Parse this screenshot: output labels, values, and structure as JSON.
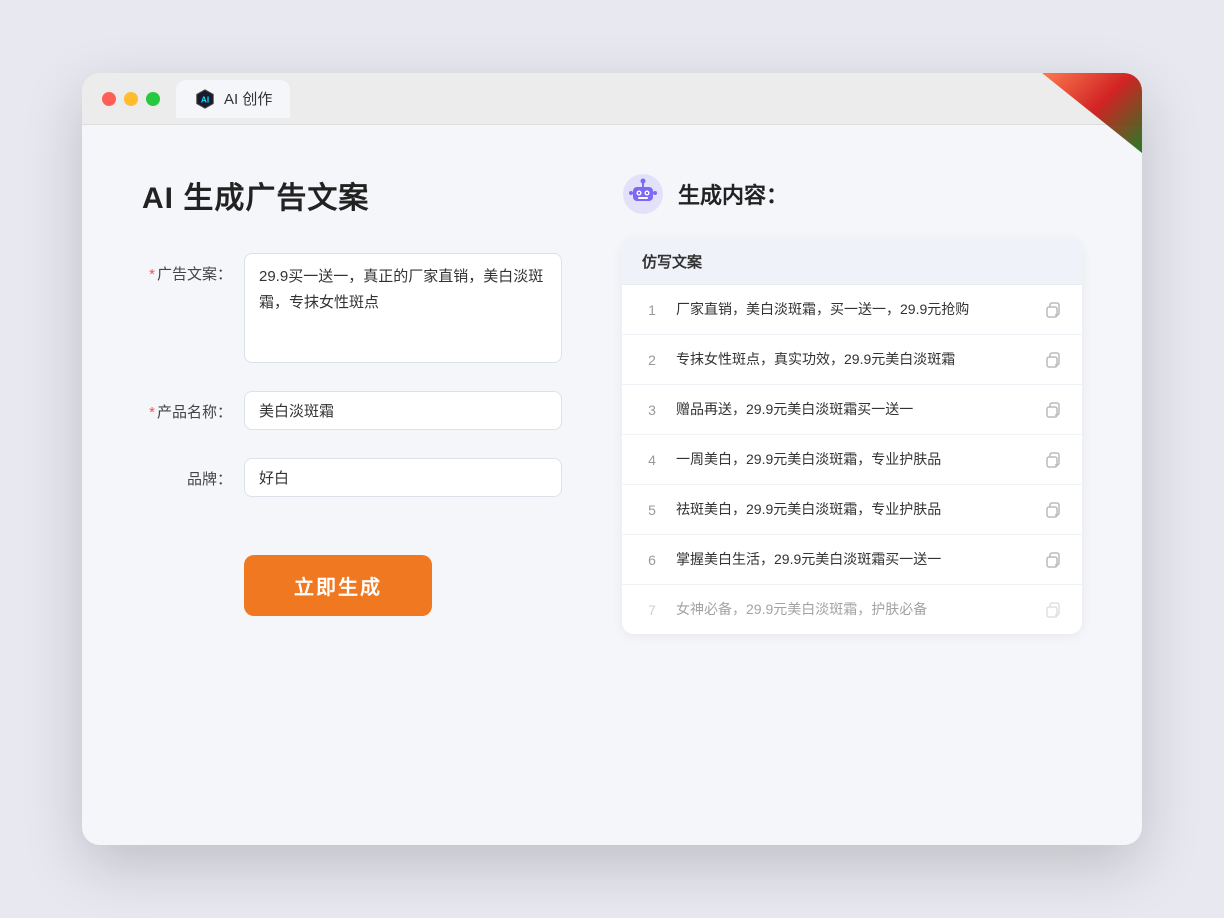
{
  "browser": {
    "tab_label": "AI 创作",
    "traffic_lights": [
      "red",
      "yellow",
      "green"
    ]
  },
  "left": {
    "page_title": "AI 生成广告文案",
    "fields": [
      {
        "id": "ad_copy",
        "label": "广告文案：",
        "required": true,
        "type": "textarea",
        "value": "29.9买一送一，真正的厂家直销，美白淡斑霜，专抹女性斑点"
      },
      {
        "id": "product_name",
        "label": "产品名称：",
        "required": true,
        "type": "input",
        "value": "美白淡斑霜"
      },
      {
        "id": "brand",
        "label": "品牌：",
        "required": false,
        "type": "input",
        "value": "好白"
      }
    ],
    "generate_btn": "立即生成"
  },
  "right": {
    "header_title": "生成内容：",
    "table_header": "仿写文案",
    "results": [
      {
        "num": "1",
        "text": "厂家直销，美白淡斑霜，买一送一，29.9元抢购",
        "faded": false
      },
      {
        "num": "2",
        "text": "专抹女性斑点，真实功效，29.9元美白淡斑霜",
        "faded": false
      },
      {
        "num": "3",
        "text": "赠品再送，29.9元美白淡斑霜买一送一",
        "faded": false
      },
      {
        "num": "4",
        "text": "一周美白，29.9元美白淡斑霜，专业护肤品",
        "faded": false
      },
      {
        "num": "5",
        "text": "祛斑美白，29.9元美白淡斑霜，专业护肤品",
        "faded": false
      },
      {
        "num": "6",
        "text": "掌握美白生活，29.9元美白淡斑霜买一送一",
        "faded": false
      },
      {
        "num": "7",
        "text": "女神必备，29.9元美白淡斑霜，护肤必备",
        "faded": true
      }
    ]
  }
}
